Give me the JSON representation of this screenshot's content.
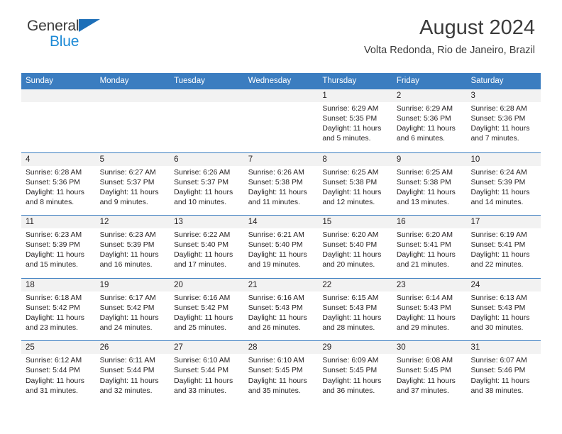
{
  "brand": {
    "name_part1": "General",
    "name_part2": "Blue",
    "triangle_color": "#1d6fb8",
    "blue_color": "#1d8ad6"
  },
  "header": {
    "title": "August 2024",
    "subtitle": "Volta Redonda, Rio de Janeiro, Brazil"
  },
  "theme": {
    "header_blue": "#3b7dc0",
    "day_band_gray": "#f2f2f2",
    "text": "#231f20"
  },
  "weekdays": [
    "Sunday",
    "Monday",
    "Tuesday",
    "Wednesday",
    "Thursday",
    "Friday",
    "Saturday"
  ],
  "weeks": [
    [
      {
        "day": "",
        "sunrise": "",
        "sunset": "",
        "daylight": "",
        "empty": true
      },
      {
        "day": "",
        "sunrise": "",
        "sunset": "",
        "daylight": "",
        "empty": true
      },
      {
        "day": "",
        "sunrise": "",
        "sunset": "",
        "daylight": "",
        "empty": true
      },
      {
        "day": "",
        "sunrise": "",
        "sunset": "",
        "daylight": "",
        "empty": true
      },
      {
        "day": "1",
        "sunrise": "Sunrise: 6:29 AM",
        "sunset": "Sunset: 5:35 PM",
        "daylight": "Daylight: 11 hours and 5 minutes."
      },
      {
        "day": "2",
        "sunrise": "Sunrise: 6:29 AM",
        "sunset": "Sunset: 5:36 PM",
        "daylight": "Daylight: 11 hours and 6 minutes."
      },
      {
        "day": "3",
        "sunrise": "Sunrise: 6:28 AM",
        "sunset": "Sunset: 5:36 PM",
        "daylight": "Daylight: 11 hours and 7 minutes."
      }
    ],
    [
      {
        "day": "4",
        "sunrise": "Sunrise: 6:28 AM",
        "sunset": "Sunset: 5:36 PM",
        "daylight": "Daylight: 11 hours and 8 minutes."
      },
      {
        "day": "5",
        "sunrise": "Sunrise: 6:27 AM",
        "sunset": "Sunset: 5:37 PM",
        "daylight": "Daylight: 11 hours and 9 minutes."
      },
      {
        "day": "6",
        "sunrise": "Sunrise: 6:26 AM",
        "sunset": "Sunset: 5:37 PM",
        "daylight": "Daylight: 11 hours and 10 minutes."
      },
      {
        "day": "7",
        "sunrise": "Sunrise: 6:26 AM",
        "sunset": "Sunset: 5:38 PM",
        "daylight": "Daylight: 11 hours and 11 minutes."
      },
      {
        "day": "8",
        "sunrise": "Sunrise: 6:25 AM",
        "sunset": "Sunset: 5:38 PM",
        "daylight": "Daylight: 11 hours and 12 minutes."
      },
      {
        "day": "9",
        "sunrise": "Sunrise: 6:25 AM",
        "sunset": "Sunset: 5:38 PM",
        "daylight": "Daylight: 11 hours and 13 minutes."
      },
      {
        "day": "10",
        "sunrise": "Sunrise: 6:24 AM",
        "sunset": "Sunset: 5:39 PM",
        "daylight": "Daylight: 11 hours and 14 minutes."
      }
    ],
    [
      {
        "day": "11",
        "sunrise": "Sunrise: 6:23 AM",
        "sunset": "Sunset: 5:39 PM",
        "daylight": "Daylight: 11 hours and 15 minutes."
      },
      {
        "day": "12",
        "sunrise": "Sunrise: 6:23 AM",
        "sunset": "Sunset: 5:39 PM",
        "daylight": "Daylight: 11 hours and 16 minutes."
      },
      {
        "day": "13",
        "sunrise": "Sunrise: 6:22 AM",
        "sunset": "Sunset: 5:40 PM",
        "daylight": "Daylight: 11 hours and 17 minutes."
      },
      {
        "day": "14",
        "sunrise": "Sunrise: 6:21 AM",
        "sunset": "Sunset: 5:40 PM",
        "daylight": "Daylight: 11 hours and 19 minutes."
      },
      {
        "day": "15",
        "sunrise": "Sunrise: 6:20 AM",
        "sunset": "Sunset: 5:40 PM",
        "daylight": "Daylight: 11 hours and 20 minutes."
      },
      {
        "day": "16",
        "sunrise": "Sunrise: 6:20 AM",
        "sunset": "Sunset: 5:41 PM",
        "daylight": "Daylight: 11 hours and 21 minutes."
      },
      {
        "day": "17",
        "sunrise": "Sunrise: 6:19 AM",
        "sunset": "Sunset: 5:41 PM",
        "daylight": "Daylight: 11 hours and 22 minutes."
      }
    ],
    [
      {
        "day": "18",
        "sunrise": "Sunrise: 6:18 AM",
        "sunset": "Sunset: 5:42 PM",
        "daylight": "Daylight: 11 hours and 23 minutes."
      },
      {
        "day": "19",
        "sunrise": "Sunrise: 6:17 AM",
        "sunset": "Sunset: 5:42 PM",
        "daylight": "Daylight: 11 hours and 24 minutes."
      },
      {
        "day": "20",
        "sunrise": "Sunrise: 6:16 AM",
        "sunset": "Sunset: 5:42 PM",
        "daylight": "Daylight: 11 hours and 25 minutes."
      },
      {
        "day": "21",
        "sunrise": "Sunrise: 6:16 AM",
        "sunset": "Sunset: 5:43 PM",
        "daylight": "Daylight: 11 hours and 26 minutes."
      },
      {
        "day": "22",
        "sunrise": "Sunrise: 6:15 AM",
        "sunset": "Sunset: 5:43 PM",
        "daylight": "Daylight: 11 hours and 28 minutes."
      },
      {
        "day": "23",
        "sunrise": "Sunrise: 6:14 AM",
        "sunset": "Sunset: 5:43 PM",
        "daylight": "Daylight: 11 hours and 29 minutes."
      },
      {
        "day": "24",
        "sunrise": "Sunrise: 6:13 AM",
        "sunset": "Sunset: 5:43 PM",
        "daylight": "Daylight: 11 hours and 30 minutes."
      }
    ],
    [
      {
        "day": "25",
        "sunrise": "Sunrise: 6:12 AM",
        "sunset": "Sunset: 5:44 PM",
        "daylight": "Daylight: 11 hours and 31 minutes."
      },
      {
        "day": "26",
        "sunrise": "Sunrise: 6:11 AM",
        "sunset": "Sunset: 5:44 PM",
        "daylight": "Daylight: 11 hours and 32 minutes."
      },
      {
        "day": "27",
        "sunrise": "Sunrise: 6:10 AM",
        "sunset": "Sunset: 5:44 PM",
        "daylight": "Daylight: 11 hours and 33 minutes."
      },
      {
        "day": "28",
        "sunrise": "Sunrise: 6:10 AM",
        "sunset": "Sunset: 5:45 PM",
        "daylight": "Daylight: 11 hours and 35 minutes."
      },
      {
        "day": "29",
        "sunrise": "Sunrise: 6:09 AM",
        "sunset": "Sunset: 5:45 PM",
        "daylight": "Daylight: 11 hours and 36 minutes."
      },
      {
        "day": "30",
        "sunrise": "Sunrise: 6:08 AM",
        "sunset": "Sunset: 5:45 PM",
        "daylight": "Daylight: 11 hours and 37 minutes."
      },
      {
        "day": "31",
        "sunrise": "Sunrise: 6:07 AM",
        "sunset": "Sunset: 5:46 PM",
        "daylight": "Daylight: 11 hours and 38 minutes."
      }
    ]
  ]
}
